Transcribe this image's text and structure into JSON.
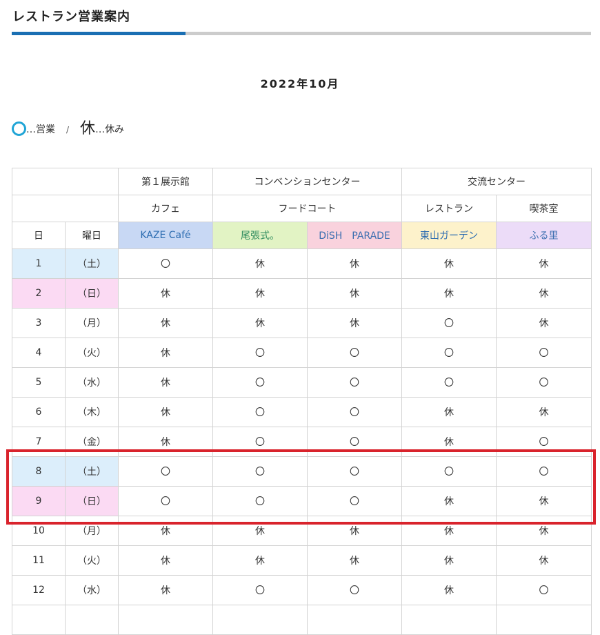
{
  "header": {
    "title": "レストラン営業案内"
  },
  "month": "2022年10月",
  "legend": {
    "open_label": "…営業",
    "separator": "/",
    "closed_symbol": "休",
    "closed_label": "…休み"
  },
  "table": {
    "venues": [
      "第１展示館",
      "コンベンションセンター",
      "交流センター"
    ],
    "categories": [
      "カフェ",
      "フードコート",
      "レストラン",
      "喫茶室"
    ],
    "col_day": "日",
    "col_weekday": "曜日",
    "stores": [
      "KAZE Café",
      "尾張式。",
      "DiSH　PARADE",
      "東山ガーデン",
      "ふる里"
    ],
    "rows": [
      {
        "day": "1",
        "weekday": "（土）",
        "type": "sat",
        "cells": [
          "〇",
          "休",
          "休",
          "休",
          "休"
        ]
      },
      {
        "day": "2",
        "weekday": "（日）",
        "type": "sun",
        "cells": [
          "休",
          "休",
          "休",
          "休",
          "休"
        ]
      },
      {
        "day": "3",
        "weekday": "（月）",
        "type": "",
        "cells": [
          "休",
          "休",
          "休",
          "〇",
          "休"
        ]
      },
      {
        "day": "4",
        "weekday": "（火）",
        "type": "",
        "cells": [
          "休",
          "〇",
          "〇",
          "〇",
          "〇"
        ]
      },
      {
        "day": "5",
        "weekday": "（水）",
        "type": "",
        "cells": [
          "休",
          "〇",
          "〇",
          "〇",
          "〇"
        ]
      },
      {
        "day": "6",
        "weekday": "（木）",
        "type": "",
        "cells": [
          "休",
          "〇",
          "〇",
          "休",
          "休"
        ]
      },
      {
        "day": "7",
        "weekday": "（金）",
        "type": "",
        "cells": [
          "休",
          "〇",
          "〇",
          "休",
          "〇"
        ]
      },
      {
        "day": "8",
        "weekday": "（土）",
        "type": "sat",
        "cells": [
          "〇",
          "〇",
          "〇",
          "〇",
          "〇"
        ]
      },
      {
        "day": "9",
        "weekday": "（日）",
        "type": "sun",
        "cells": [
          "〇",
          "〇",
          "〇",
          "休",
          "休"
        ]
      },
      {
        "day": "10",
        "weekday": "（月）",
        "type": "",
        "cells": [
          "休",
          "休",
          "休",
          "休",
          "休"
        ]
      },
      {
        "day": "11",
        "weekday": "（火）",
        "type": "",
        "cells": [
          "休",
          "休",
          "休",
          "休",
          "休"
        ]
      },
      {
        "day": "12",
        "weekday": "（水）",
        "type": "",
        "cells": [
          "休",
          "〇",
          "〇",
          "休",
          "〇"
        ]
      },
      {
        "day": "",
        "weekday": "",
        "type": "",
        "cells": [
          "",
          "",
          "",
          "",
          ""
        ]
      }
    ]
  },
  "colors": {
    "accent": "#1a6fb3",
    "open_circle": "#21a5d6",
    "highlight": "#d9232c"
  }
}
